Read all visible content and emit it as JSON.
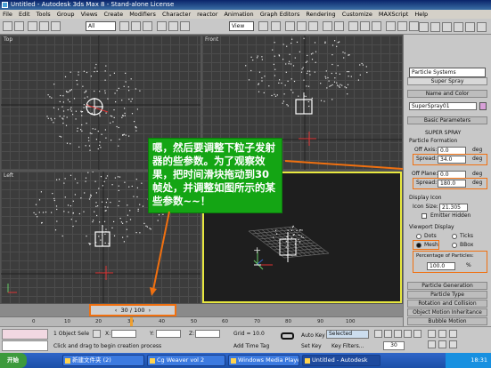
{
  "window": {
    "title": "Untitled - Autodesk 3ds Max 8 - Stand-alone License"
  },
  "menu": [
    "File",
    "Edit",
    "Tools",
    "Group",
    "Views",
    "Create",
    "Modifiers",
    "Character",
    "reactor",
    "Animation",
    "Graph Editors",
    "Rendering",
    "Customize",
    "MAXScript",
    "Help"
  ],
  "toolbar": {
    "selection_filter": "All",
    "view_dropdown": "View"
  },
  "viewports": {
    "top_label": "Top",
    "front_label": "Front",
    "left_label": "Left"
  },
  "annotation": {
    "text": "嗯，然后要调整下粒子发射器的些参数。为了观察效果，把时间滑块拖动到30帧处，并调整如图所示的某些参数~~！"
  },
  "command_panel": {
    "category": "Particle Systems",
    "type_button": "Super Spray",
    "name_color_header": "Name and Color",
    "object_name": "SuperSpray01",
    "object_color": "#d8a0d8",
    "basic_params_header": "Basic Parameters",
    "brand_label": "SUPER SPRAY",
    "particle_formation_label": "Particle Formation",
    "off_axis_label": "Off Axis:",
    "off_axis_value": "0.0",
    "spread1_label": "Spread:",
    "spread1_value": "34.0",
    "off_plane_label": "Off Plane:",
    "off_plane_value": "0.0",
    "spread2_label": "Spread:",
    "spread2_value": "180.0",
    "deg": "deg",
    "display_icon_label": "Display Icon",
    "icon_size_label": "Icon Size:",
    "icon_size_value": "21.305",
    "emitter_hidden_label": "Emitter Hidden",
    "viewport_display_label": "Viewport Display",
    "dots_label": "Dots",
    "ticks_label": "Ticks",
    "mesh_label": "Mesh",
    "bbox_label": "BBox",
    "percentage_label": "Percentage of Particles:",
    "percentage_value": "100.0",
    "percent_sign": "%",
    "rollouts": [
      "Particle Generation",
      "Particle Type",
      "Rotation and Collision",
      "Object Motion Inheritance",
      "Bubble Motion"
    ]
  },
  "timeline": {
    "slider_label": "30 / 100",
    "ticks": [
      "0",
      "10",
      "20",
      "30",
      "40",
      "50",
      "60",
      "70",
      "80",
      "90",
      "100"
    ]
  },
  "status": {
    "selection": "1 Object Sele",
    "prompt": "Click and drag to begin creation process",
    "x_label": "X:",
    "y_label": "Y:",
    "z_label": "Z:",
    "grid": "Grid = 10.0",
    "add_time_tag": "Add Time Tag",
    "auto_key": "Auto Key",
    "selected": "Selected",
    "set_key": "Set Key",
    "key_filters": "Key Filters...",
    "frame": "30"
  },
  "taskbar": {
    "start": "开始",
    "items": [
      "新建文件夹 (2)",
      "Cg Weaver vol 2",
      "Windows Media Player",
      "Untitled - Autodesk"
    ],
    "clock": "18:31"
  }
}
